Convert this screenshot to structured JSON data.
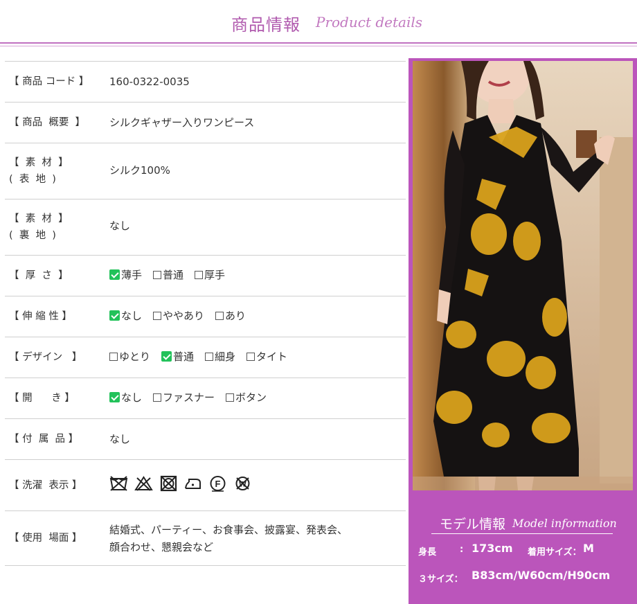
{
  "header": {
    "title": "商品情報",
    "subtitle": "Product details"
  },
  "specs": [
    {
      "label": "【 商品 コード 】",
      "value": "160-0322-0035"
    },
    {
      "label": "【 商品  概要  】",
      "value": "シルクギャザー入りワンピース"
    },
    {
      "label": "【  素  材  】",
      "label2": "(  表  地  )",
      "value": "シルク100%"
    },
    {
      "label": "【  素  材  】",
      "label2": "(  裏  地  )",
      "value": "なし"
    },
    {
      "label": "【  厚  さ  】",
      "options": [
        {
          "text": "薄手",
          "checked": true
        },
        {
          "text": "普通",
          "checked": false
        },
        {
          "text": "厚手",
          "checked": false
        }
      ]
    },
    {
      "label": "【 伸 縮 性 】",
      "options": [
        {
          "text": "なし",
          "checked": true
        },
        {
          "text": "ややあり",
          "checked": false
        },
        {
          "text": "あり",
          "checked": false
        }
      ]
    },
    {
      "label": "【 デザイン   】",
      "options": [
        {
          "text": "ゆとり",
          "checked": false
        },
        {
          "text": "普通",
          "checked": true
        },
        {
          "text": "細身",
          "checked": false
        },
        {
          "text": "タイト",
          "checked": false
        }
      ]
    },
    {
      "label": "【 開      き 】",
      "options": [
        {
          "text": "なし",
          "checked": true
        },
        {
          "text": "ファスナー",
          "checked": false
        },
        {
          "text": "ボタン",
          "checked": false
        }
      ]
    },
    {
      "label": "【 付  属  品 】",
      "value": "なし"
    },
    {
      "label": "【 洗濯  表示 】",
      "wash_icons": [
        "no-wash-icon",
        "no-bleach-icon",
        "no-tumble-dry-icon",
        "iron-low-icon",
        "dry-clean-f-icon",
        "no-wet-clean-icon"
      ]
    },
    {
      "label": "【 使用  場面 】",
      "value": "結婚式、パーティー、お食事会、披露宴、発表会、",
      "value2": "顔合わせ、懇親会など"
    }
  ],
  "model": {
    "title": "モデル情報",
    "subtitle": "Model information",
    "height_label": "身長",
    "height_colon": ":",
    "height_value": "173cm",
    "size_label": "着用サイズ：",
    "size_value": "M",
    "three_label": "３サイズ：",
    "three_value": "B83cm/W60cm/H90cm"
  },
  "colors": {
    "accent": "#bb55bb",
    "check": "#22c25a",
    "title": "#b05aae"
  }
}
